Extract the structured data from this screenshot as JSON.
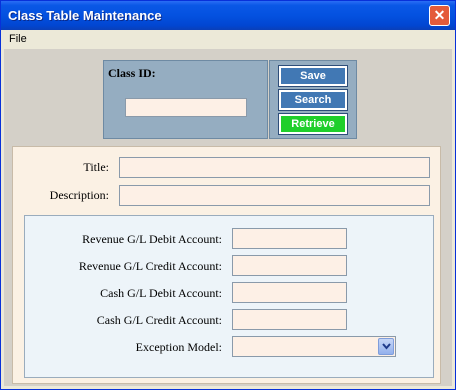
{
  "window": {
    "title": "Class Table Maintenance",
    "close_glyph": "✕"
  },
  "menu": {
    "items": [
      "File"
    ]
  },
  "class_id": {
    "label": "Class ID:",
    "value": ""
  },
  "buttons": {
    "save": "Save",
    "search": "Search",
    "retrieve": "Retrieve"
  },
  "form": {
    "title_label": "Title:",
    "title_value": "",
    "description_label": "Description:",
    "description_value": ""
  },
  "accounts": {
    "revenue_debit_label": "Revenue G/L Debit Account:",
    "revenue_credit_label": "Revenue G/L Credit Account:",
    "cash_debit_label": "Cash G/L Debit Account:",
    "cash_credit_label": "Cash G/L Credit Account:",
    "exception_model_label": "Exception Model:",
    "exception_model_value": ""
  },
  "colors": {
    "title_bar": "#0451e0",
    "close_button": "#e45b3a",
    "panel": "#95adc1",
    "blue_button": "#4178b4",
    "green_button": "#1fcf2b",
    "field_bg": "#fdf0e6",
    "form_bg": "#fbf1e4"
  },
  "icons": {
    "close": "close-icon",
    "dropdown": "chevron-down-icon"
  }
}
